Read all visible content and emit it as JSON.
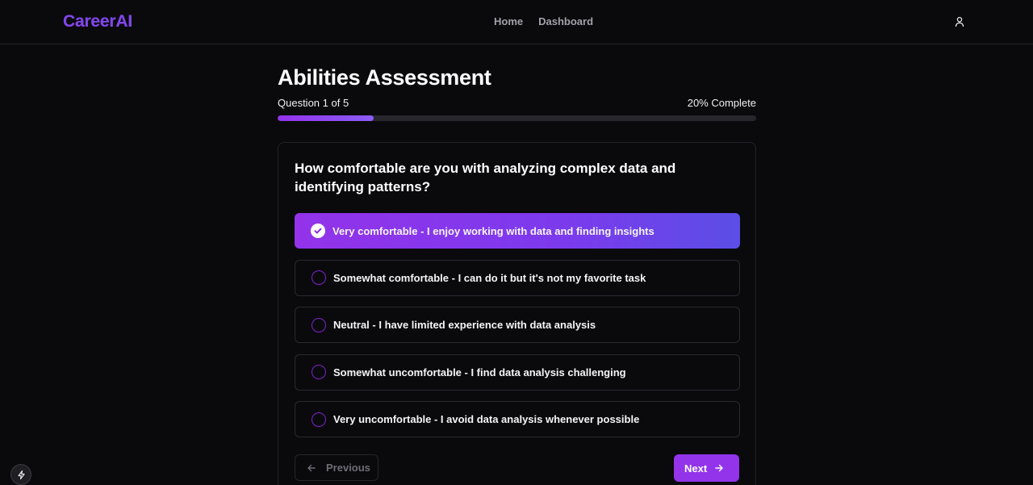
{
  "app": {
    "brand": "CareerAI"
  },
  "nav": {
    "items": [
      {
        "label": "Home"
      },
      {
        "label": "Dashboard"
      }
    ]
  },
  "header": {
    "user_icon": "user-icon"
  },
  "assessment": {
    "title": "Abilities Assessment",
    "question_counter": "Question 1 of 5",
    "progress_text": "20% Complete",
    "progress_fraction": 0.2,
    "question": "How comfortable are you with analyzing complex data and identifying patterns?",
    "options": [
      {
        "label": "Very comfortable - I enjoy working with data and finding insights",
        "selected": true
      },
      {
        "label": "Somewhat comfortable - I can do it but it's not my favorite task",
        "selected": false
      },
      {
        "label": "Neutral - I have limited experience with data analysis",
        "selected": false
      },
      {
        "label": "Somewhat uncomfortable - I find data analysis challenging",
        "selected": false
      },
      {
        "label": "Very uncomfortable - I avoid data analysis whenever possible",
        "selected": false
      }
    ],
    "previous_label": "Previous",
    "next_label": "Next"
  },
  "colors": {
    "accent": "#9333ea",
    "accent_gradient_end": "#5b4ee6",
    "background": "#0a090c",
    "border": "#2a2930"
  }
}
